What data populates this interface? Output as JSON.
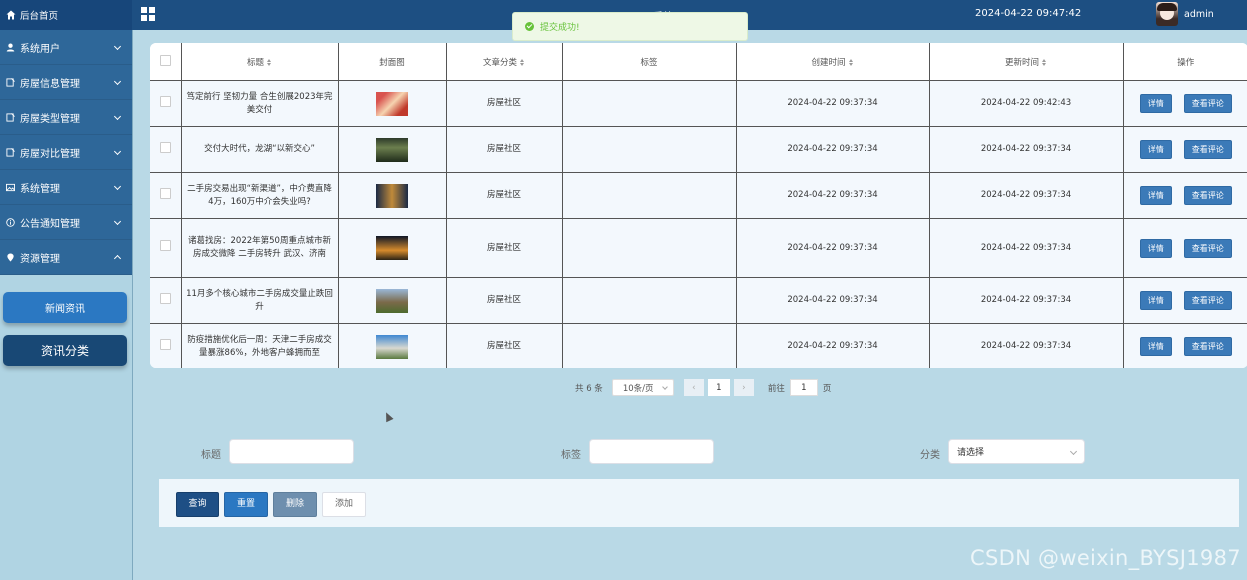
{
  "header": {
    "home_label": "后台首页",
    "system_title": "… 系统",
    "datetime": "2024-04-22 09:47:42",
    "username": "admin"
  },
  "toast": {
    "message": "提交成功!"
  },
  "sidebar": {
    "items": [
      {
        "label": "系统用户",
        "icon": "user-icon"
      },
      {
        "label": "房屋信息管理",
        "icon": "document-icon"
      },
      {
        "label": "房屋类型管理",
        "icon": "document-icon"
      },
      {
        "label": "房屋对比管理",
        "icon": "document-icon"
      },
      {
        "label": "系统管理",
        "icon": "image-icon"
      },
      {
        "label": "公告通知管理",
        "icon": "info-icon"
      },
      {
        "label": "资源管理",
        "icon": "location-pin-icon"
      }
    ],
    "sub_items": [
      "新闻资讯",
      "资讯分类"
    ]
  },
  "table": {
    "headers": [
      "标题",
      "封面图",
      "文章分类",
      "标签",
      "创建时间",
      "更新时间",
      "操作"
    ],
    "action_detail": "详情",
    "action_comments": "查看评论",
    "rows": [
      {
        "title": "笃定前行 坚韧力量 合生创展2023年完美交付",
        "category": "房屋社区",
        "tag": "",
        "created": "2024-04-22 09:37:34",
        "updated": "2024-04-22 09:42:43"
      },
      {
        "title": "交付大时代，龙湖“以新交心”",
        "category": "房屋社区",
        "tag": "",
        "created": "2024-04-22 09:37:34",
        "updated": "2024-04-22 09:37:34"
      },
      {
        "title": "二手房交易出现“新渠道”，中介费直降4万，160万中介会失业吗?",
        "category": "房屋社区",
        "tag": "",
        "created": "2024-04-22 09:37:34",
        "updated": "2024-04-22 09:37:34"
      },
      {
        "title": "诸葛找房：2022年第50周重点城市新房成交微降 二手房转升 武汉、济南",
        "category": "房屋社区",
        "tag": "",
        "created": "2024-04-22 09:37:34",
        "updated": "2024-04-22 09:37:34"
      },
      {
        "title": "11月多个核心城市二手房成交量止跌回升",
        "category": "房屋社区",
        "tag": "",
        "created": "2024-04-22 09:37:34",
        "updated": "2024-04-22 09:37:34"
      },
      {
        "title": "防疫措施优化后一周：天津二手房成交量暴涨86%，外地客户蜂拥而至",
        "category": "房屋社区",
        "tag": "",
        "created": "2024-04-22 09:37:34",
        "updated": "2024-04-22 09:37:34"
      }
    ]
  },
  "pagination": {
    "total": "共 6 条",
    "page_size": "10条/页",
    "prev": "‹",
    "current_page": "1",
    "next": "›",
    "goto_label": "前往",
    "goto_value": "1",
    "page_suffix": "页"
  },
  "filters": {
    "title_label": "标题",
    "tag_label": "标签",
    "category_label": "分类",
    "category_value": "请选择"
  },
  "actions": {
    "query": "查询",
    "reset": "重置",
    "delete": "删除",
    "add": "添加"
  },
  "watermark": "CSDN @weixin_BYSJ1987"
}
